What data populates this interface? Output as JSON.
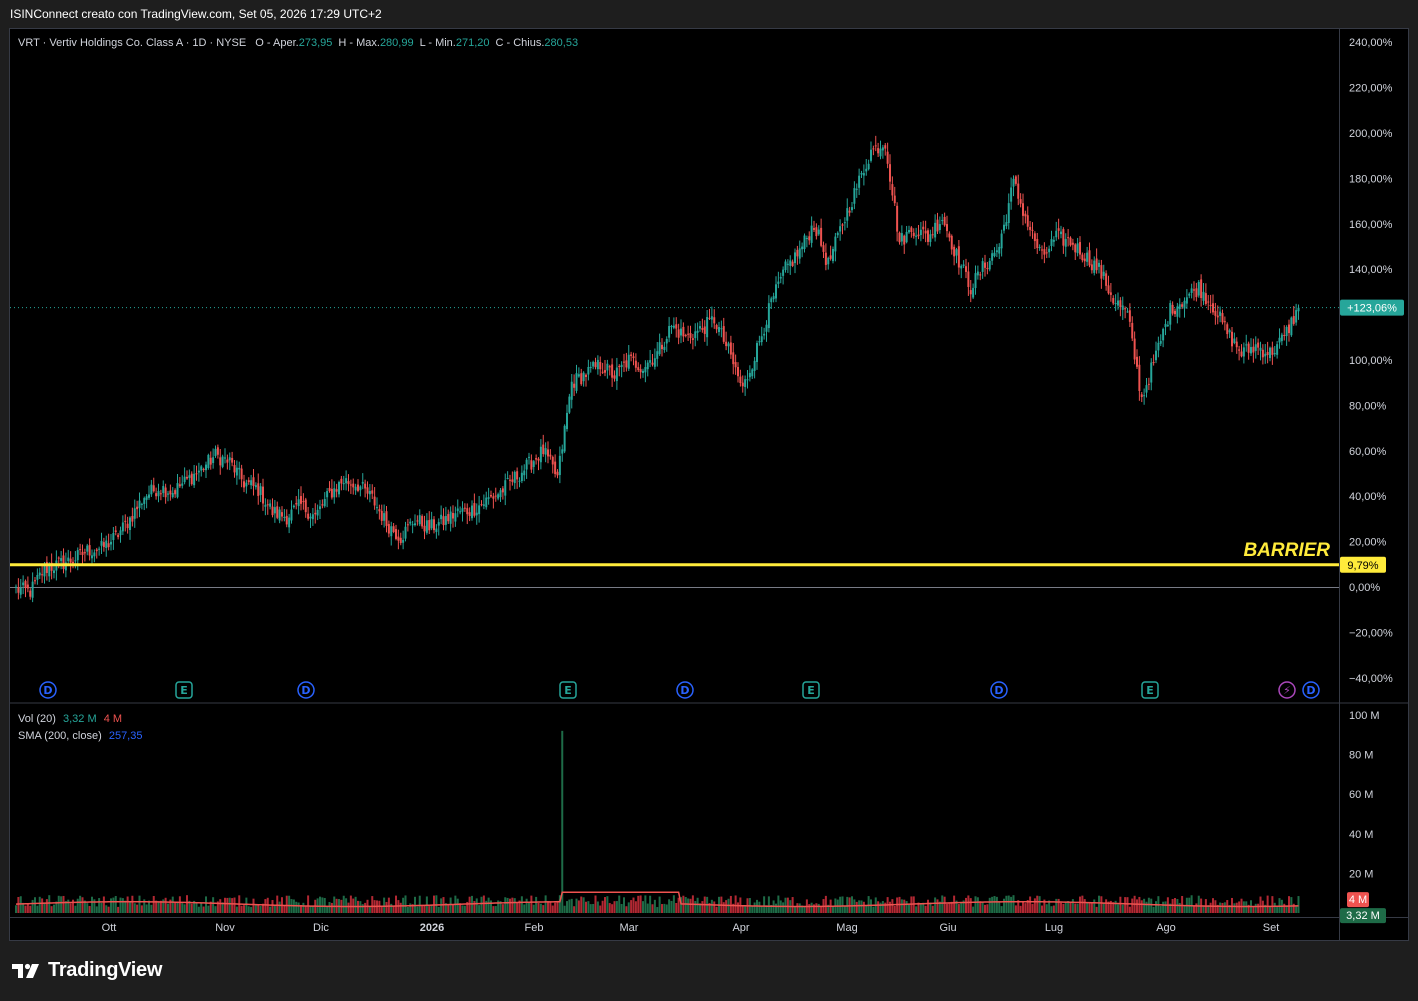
{
  "header": {
    "attribution": "ISINConnect creato con TradingView.com, Set 05, 2026 17:29 UTC+2"
  },
  "symbol": {
    "name": "VRT · Vertiv Holdings Co. Class A · 1D · NYSE",
    "ohlc": [
      {
        "label": "O - Aper.",
        "value": "273,95"
      },
      {
        "label": "H - Max.",
        "value": "280,99"
      },
      {
        "label": "L - Min.",
        "value": "271,20"
      },
      {
        "label": "C - Chius.",
        "value": "280,53"
      }
    ]
  },
  "indicators": {
    "vol_label": "Vol (20)",
    "vol_value": "3,32 M",
    "vol_ma": "4 M",
    "sma_label": "SMA (200, close)",
    "sma_value": "257,35"
  },
  "colors": {
    "up": "#26a69a",
    "down": "#ef5350",
    "vol_up": "#1e6b47",
    "vol_down": "#b22833",
    "barrier": "#ffeb3b",
    "event_dividend": "#2962ff",
    "event_earnings": "#26a69a",
    "event_split": "#ab47bc"
  },
  "chart_data": {
    "type": "candlestick",
    "y_axis": {
      "unit": "%",
      "min": -45,
      "max": 245,
      "ticks": [
        "240,00%",
        "220,00%",
        "200,00%",
        "180,00%",
        "160,00%",
        "140,00%",
        "120,00%",
        "100,00%",
        "80,00%",
        "60,00%",
        "40,00%",
        "20,00%",
        "0,00%",
        "−20,00%",
        "−40,00%"
      ]
    },
    "x_axis": {
      "ticks": [
        "Ott",
        "Nov",
        "Dic",
        "2026",
        "Feb",
        "Mar",
        "Apr",
        "Mag",
        "Giu",
        "Lug",
        "Ago",
        "Set"
      ]
    },
    "current_value": "+123,06%",
    "barrier": {
      "label": "BARRIER",
      "value": 9.79,
      "value_label": "9,79%"
    },
    "events": [
      {
        "type": "dividend",
        "icon": "D",
        "date": "Set"
      },
      {
        "type": "earnings",
        "icon": "E",
        "date": "Ott"
      },
      {
        "type": "dividend",
        "icon": "D",
        "date": "Nov"
      },
      {
        "type": "earnings",
        "icon": "E",
        "date": "Feb"
      },
      {
        "type": "dividend",
        "icon": "D",
        "date": "Mar"
      },
      {
        "type": "earnings",
        "icon": "E",
        "date": "Apr"
      },
      {
        "type": "dividend",
        "icon": "D",
        "date": "Giu"
      },
      {
        "type": "earnings",
        "icon": "E",
        "date": "Lug"
      },
      {
        "type": "split",
        "icon": "⚡",
        "date": "Set"
      },
      {
        "type": "dividend",
        "icon": "D",
        "date": "Set"
      }
    ],
    "close_series": [
      [
        0,
        -1
      ],
      [
        6,
        -2
      ],
      [
        12,
        8
      ],
      [
        18,
        10
      ],
      [
        24,
        12
      ],
      [
        30,
        16
      ],
      [
        36,
        17
      ],
      [
        42,
        22
      ],
      [
        48,
        30
      ],
      [
        54,
        40
      ],
      [
        60,
        44
      ],
      [
        66,
        42
      ],
      [
        72,
        47
      ],
      [
        78,
        52
      ],
      [
        84,
        58
      ],
      [
        90,
        55
      ],
      [
        96,
        46
      ],
      [
        102,
        43
      ],
      [
        108,
        33
      ],
      [
        114,
        31
      ],
      [
        120,
        36
      ],
      [
        126,
        31
      ],
      [
        132,
        41
      ],
      [
        138,
        47
      ],
      [
        144,
        45
      ],
      [
        150,
        39
      ],
      [
        156,
        28
      ],
      [
        162,
        22
      ],
      [
        168,
        30
      ],
      [
        174,
        26
      ],
      [
        180,
        29
      ],
      [
        186,
        33
      ],
      [
        192,
        34
      ],
      [
        198,
        38
      ],
      [
        204,
        42
      ],
      [
        210,
        48
      ],
      [
        216,
        54
      ],
      [
        222,
        60
      ],
      [
        228,
        48
      ],
      [
        234,
        90
      ],
      [
        240,
        94
      ],
      [
        246,
        98
      ],
      [
        252,
        93
      ],
      [
        258,
        100
      ],
      [
        264,
        97
      ],
      [
        270,
        103
      ],
      [
        276,
        115
      ],
      [
        282,
        110
      ],
      [
        288,
        113
      ],
      [
        294,
        118
      ],
      [
        300,
        104
      ],
      [
        306,
        87
      ],
      [
        312,
        105
      ],
      [
        318,
        125
      ],
      [
        324,
        140
      ],
      [
        330,
        148
      ],
      [
        336,
        160
      ],
      [
        342,
        142
      ],
      [
        348,
        160
      ],
      [
        354,
        176
      ],
      [
        360,
        192
      ],
      [
        366,
        196
      ],
      [
        372,
        152
      ],
      [
        378,
        158
      ],
      [
        384,
        154
      ],
      [
        390,
        163
      ],
      [
        396,
        146
      ],
      [
        402,
        132
      ],
      [
        408,
        142
      ],
      [
        414,
        150
      ],
      [
        420,
        178
      ],
      [
        426,
        160
      ],
      [
        432,
        145
      ],
      [
        438,
        154
      ],
      [
        444,
        152
      ],
      [
        450,
        146
      ],
      [
        456,
        140
      ],
      [
        462,
        127
      ],
      [
        468,
        120
      ],
      [
        474,
        83
      ],
      [
        480,
        102
      ],
      [
        486,
        122
      ],
      [
        492,
        127
      ],
      [
        498,
        132
      ],
      [
        504,
        124
      ],
      [
        510,
        112
      ],
      [
        516,
        103
      ],
      [
        522,
        106
      ],
      [
        528,
        103
      ],
      [
        534,
        110
      ],
      [
        540,
        123
      ]
    ],
    "volume_panel": {
      "y_ticks": [
        "100 M",
        "80 M",
        "60 M",
        "40 M",
        "20 M"
      ],
      "vol_ma_label": "4 M",
      "last_volume_label": "3,32 M",
      "spikes": [
        {
          "day": 72,
          "value": 9
        },
        {
          "day": 230,
          "value": 92
        },
        {
          "day": 420,
          "value": 9
        },
        {
          "day": 468,
          "value": 8
        }
      ]
    }
  }
}
